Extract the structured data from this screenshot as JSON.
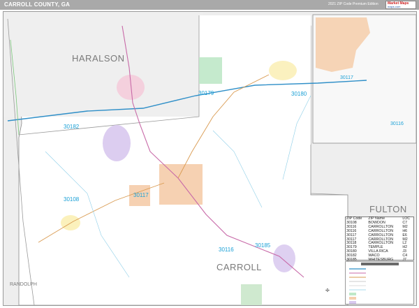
{
  "header": {
    "title": "CARROLL COUNTY, GA",
    "edition": "2021 ZIP Code Premium Edition",
    "brand_line1": "Market Maps",
    "brand_line2": "maps.com"
  },
  "labels": {
    "counties": {
      "haralson": "HARALSON",
      "carroll": "CARROLL",
      "fulton": "FULTON",
      "randolph": "RANDOLPH"
    },
    "zips": [
      "30179",
      "30180",
      "30182",
      "30117",
      "30108",
      "30116",
      "30185"
    ],
    "inset_zips": [
      "30117",
      "30116"
    ]
  },
  "zip_table": {
    "headers": [
      "ZIP Code",
      "ZIP Name",
      "LOC"
    ],
    "rows": [
      [
        "30108",
        "BOWDON",
        "C7"
      ],
      [
        "30116",
        "CARROLLTON",
        "M2"
      ],
      [
        "30116",
        "CARROLLTON",
        "H6"
      ],
      [
        "30117",
        "CARROLLTON",
        "E6"
      ],
      [
        "30117",
        "CARROLLTON",
        "M2"
      ],
      [
        "30118",
        "CARROLLTON",
        "L2"
      ],
      [
        "30179",
        "TEMPLE",
        "H2"
      ],
      [
        "30180",
        "VILLA RICA",
        "J3"
      ],
      [
        "30182",
        "WACO",
        "C4"
      ],
      [
        "30185",
        "WHITESBURG",
        "J7"
      ]
    ]
  },
  "colors": {
    "zip_label": "#1aa0d6",
    "interstate": "#2f8fc8",
    "highway": "#c86aa8",
    "county_bg": "#ffffff",
    "outside_bg": "#eeeeee",
    "water": "#8ecfe8"
  }
}
